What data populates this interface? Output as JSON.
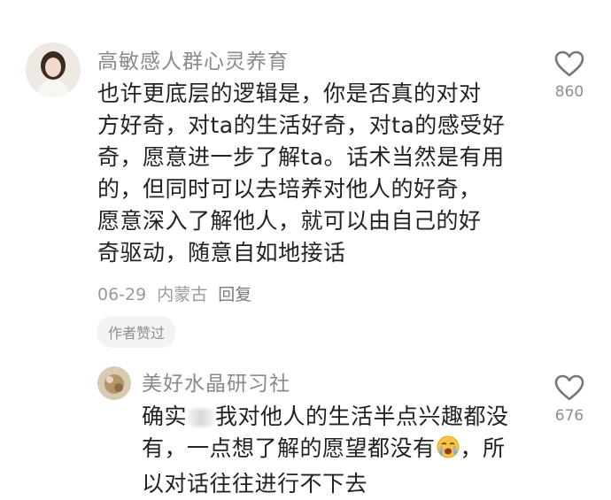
{
  "comments": [
    {
      "username": "高敏感人群心灵养育",
      "lines": [
        "也许更底层的逻辑是，你是否真的对对",
        "方好奇，对ta的生活好奇，对ta的感受好",
        "奇，愿意进一步了解ta。话术当然是有用",
        "的，但同时可以去培养对他人的好奇，",
        "愿意深入了解他人，就可以由自己的好",
        "奇驱动，随意自如地接话"
      ],
      "date": "06-29",
      "location": "内蒙古",
      "reply_label": "回复",
      "badge": "作者赞过",
      "likes": "860",
      "like_icon": "heart-outline-icon"
    },
    {
      "username": "美好水晶研习社",
      "line1_start": "确实",
      "line1_end": "我对他人的生活半点兴趣都没",
      "line2_start": "有，一点想了解的愿望都没有",
      "line2_end": "，所",
      "line3": "以对话往往进行不下去",
      "emoji_icon": "crying-face-icon",
      "likes": "676",
      "like_icon": "heart-outline-icon"
    }
  ]
}
